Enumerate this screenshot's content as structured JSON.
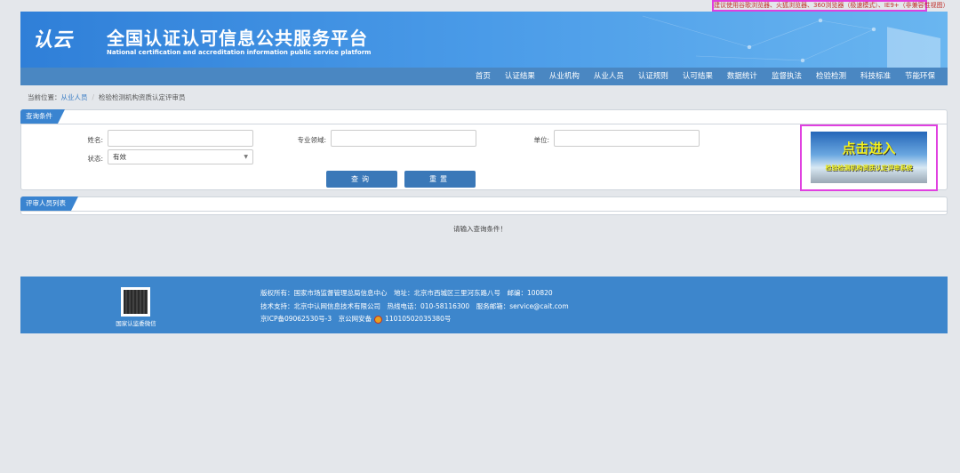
{
  "browser_tip": "建议使用谷歌浏览器、火狐浏览器、360浏览器（极速模式）、IE9+（非兼容性视图）",
  "header": {
    "logo": "认云",
    "title": "全国认证认可信息公共服务平台",
    "subtitle": "National certification and accreditation information public service platform"
  },
  "nav": [
    "首页",
    "认证结果",
    "从业机构",
    "从业人员",
    "认证规则",
    "认可结果",
    "数据统计",
    "监督执法",
    "检验检测",
    "科技标准",
    "节能环保"
  ],
  "breadcrumb": {
    "label": "当前位置：",
    "link": "从业人员",
    "current": "检验检测机构资质认定评审员"
  },
  "query": {
    "tab": "查询条件",
    "name_label": "姓名:",
    "name_value": "",
    "field_label": "专业领域:",
    "field_value": "",
    "unit_label": "单位:",
    "unit_value": "",
    "status_label": "状态:",
    "status_value": "有效",
    "search": "查询",
    "reset": "重置"
  },
  "promo": {
    "title": "点击进入",
    "subtitle": "检验检测机构资质认定评审系统"
  },
  "list": {
    "tab": "评审人员列表",
    "message": "请输入查询条件！"
  },
  "footer": {
    "qr_label": "国家认监委微信",
    "line1": "版权所有：国家市场监督管理总局信息中心　地址：北京市西城区三里河东路八号　邮编：100820",
    "line2": "技术支持：北京中认网信息技术有限公司　热线电话：010-58116300　服务邮箱：service@cait.com",
    "icp": "京ICP备09062530号-3　京公网安备",
    "police": "11010502035380号"
  }
}
